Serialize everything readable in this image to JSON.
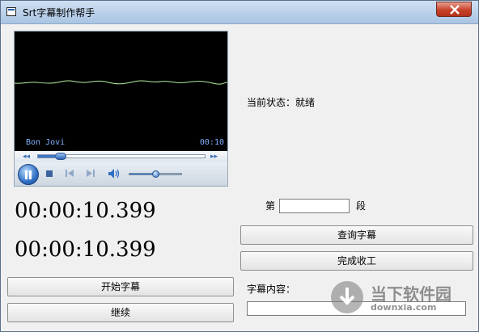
{
  "window": {
    "title": "Srt字幕制作帮手"
  },
  "player": {
    "artist": "Bon Jovi",
    "time": "00:10",
    "seek_progress": 0.1,
    "volume": 0.5,
    "state": "playing"
  },
  "times": {
    "start": "00:00:10.399",
    "end": "00:00:10.399"
  },
  "status": {
    "text": "当前状态：就绪"
  },
  "segment": {
    "prefix": "第",
    "suffix": "段",
    "value": ""
  },
  "buttons": {
    "query": "查询字幕",
    "finish": "完成收工",
    "start": "开始字幕",
    "continue": "继续"
  },
  "content": {
    "label": "字幕内容：",
    "value": ""
  },
  "watermark": {
    "name": "当下软件园",
    "url": "downxia.com"
  },
  "colors": {
    "video_bg": "#000000",
    "waveform": "#b4f0a0",
    "overlay_text": "#7fb0ff",
    "accent": "#2f6fc4"
  }
}
